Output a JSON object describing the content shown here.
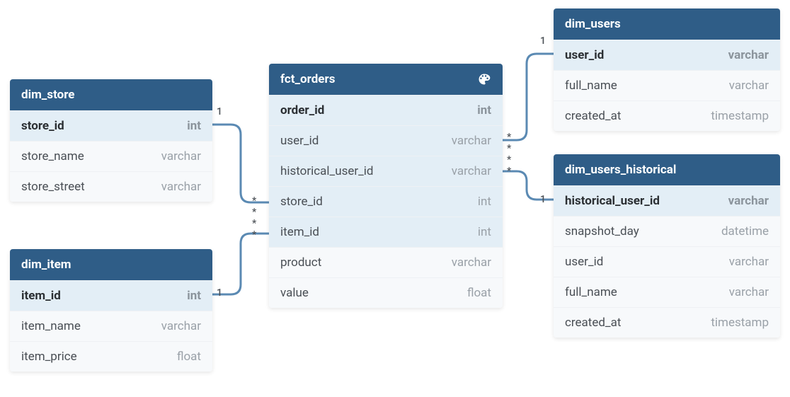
{
  "tables": {
    "dim_store": {
      "title": "dim_store",
      "columns": [
        {
          "name": "store_id",
          "type": "int",
          "role": "pk"
        },
        {
          "name": "store_name",
          "type": "varchar",
          "role": "plain"
        },
        {
          "name": "store_street",
          "type": "varchar",
          "role": "plain"
        }
      ]
    },
    "dim_item": {
      "title": "dim_item",
      "columns": [
        {
          "name": "item_id",
          "type": "int",
          "role": "pk"
        },
        {
          "name": "item_name",
          "type": "varchar",
          "role": "plain"
        },
        {
          "name": "item_price",
          "type": "float",
          "role": "plain"
        }
      ]
    },
    "fct_orders": {
      "title": "fct_orders",
      "header_icon": "palette",
      "columns": [
        {
          "name": "order_id",
          "type": "int",
          "role": "pk"
        },
        {
          "name": "user_id",
          "type": "varchar",
          "role": "fk"
        },
        {
          "name": "historical_user_id",
          "type": "varchar",
          "role": "fk"
        },
        {
          "name": "store_id",
          "type": "int",
          "role": "fk"
        },
        {
          "name": "item_id",
          "type": "int",
          "role": "fk"
        },
        {
          "name": "product",
          "type": "varchar",
          "role": "plain"
        },
        {
          "name": "value",
          "type": "float",
          "role": "plain"
        }
      ]
    },
    "dim_users": {
      "title": "dim_users",
      "columns": [
        {
          "name": "user_id",
          "type": "varchar",
          "role": "pk"
        },
        {
          "name": "full_name",
          "type": "varchar",
          "role": "plain"
        },
        {
          "name": "created_at",
          "type": "timestamp",
          "role": "plain"
        }
      ]
    },
    "dim_users_historical": {
      "title": "dim_users_historical",
      "columns": [
        {
          "name": "historical_user_id",
          "type": "varchar",
          "role": "pk"
        },
        {
          "name": "snapshot_day",
          "type": "datetime",
          "role": "plain"
        },
        {
          "name": "user_id",
          "type": "varchar",
          "role": "plain"
        },
        {
          "name": "full_name",
          "type": "varchar",
          "role": "plain"
        },
        {
          "name": "created_at",
          "type": "timestamp",
          "role": "plain"
        }
      ]
    }
  },
  "relationships": [
    {
      "from_table": "fct_orders",
      "from_column": "store_id",
      "from_card": "*",
      "to_table": "dim_store",
      "to_column": "store_id",
      "to_card": "1"
    },
    {
      "from_table": "fct_orders",
      "from_column": "item_id",
      "from_card": "*",
      "to_table": "dim_item",
      "to_column": "item_id",
      "to_card": "1"
    },
    {
      "from_table": "fct_orders",
      "from_column": "user_id",
      "from_card": "*",
      "to_table": "dim_users",
      "to_column": "user_id",
      "to_card": "1"
    },
    {
      "from_table": "fct_orders",
      "from_column": "historical_user_id",
      "from_card": "*",
      "to_table": "dim_users_historical",
      "to_column": "historical_user_id",
      "to_card": "1"
    }
  ],
  "cardinality_labels": {
    "store_one": "1",
    "store_many": "*",
    "item_one": "1",
    "item_many": "*",
    "users_one": "1",
    "users_many": "*",
    "hist_one": "1",
    "hist_many": "*"
  }
}
